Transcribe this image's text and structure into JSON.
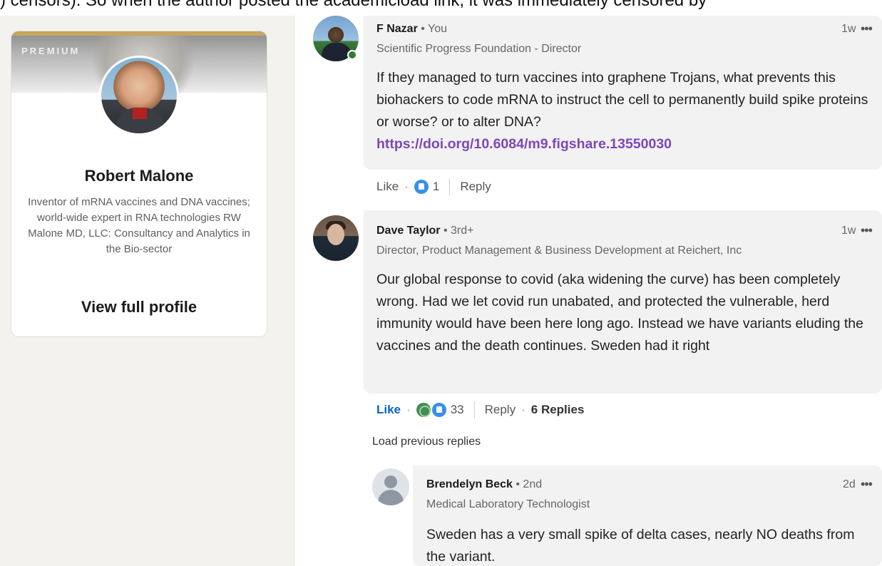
{
  "top_text": ") censors). So when the author posted the academicload link, it was immediately censored by",
  "profile_card": {
    "premium_label": "PREMIUM",
    "name": "Robert Malone",
    "headline": "Inventor of mRNA vaccines and DNA vaccines; world-wide expert in RNA technologies RW Malone MD, LLC: Consultancy and Analytics in the Bio-sector",
    "view_profile": "View full profile"
  },
  "comments": [
    {
      "name": "F Nazar",
      "degree": " • You",
      "title": "Scientific Progress Foundation - Director",
      "time": "1w",
      "more": "•••",
      "body": "If they managed to turn vaccines into graphene Trojans, what prevents this biohackers to code mRNA to instruct the cell to permanently build spike proteins or worse? or to alter DNA?",
      "link": "https://doi.org/10.6084/m9.figshare.13550030",
      "like": "Like",
      "dot": "·",
      "reaction_count": "1",
      "reply": "Reply"
    },
    {
      "name": "Dave Taylor",
      "degree": " • 3rd+",
      "title": "Director, Product Management & Business Development at Reichert, Inc",
      "time": "1w",
      "more": "•••",
      "body": "Our global response to covid (aka widening the curve) has been completely wrong. Had we let covid run unabated, and protected the vulnerable, herd immunity would have been here long ago. Instead we have variants eluding the vaccines and the death continues. Sweden had it right",
      "like": "Like",
      "dot": "·",
      "reaction_count": "33",
      "reply": "Reply",
      "replies": "6 Replies"
    }
  ],
  "load_previous": "Load previous replies",
  "reply": {
    "name": "Brendelyn Beck",
    "degree": " • 2nd",
    "title": "Medical Laboratory Technologist",
    "time": "2d",
    "more": "•••",
    "body": "Sweden has a very small spike of delta cases, nearly NO deaths from the variant."
  },
  "colors": {
    "like_blue": "#0a66c2",
    "link_purple": "#7d47b8",
    "online_green": "#2e7d32",
    "bubble_bg": "#f2f2f2",
    "rail_bg": "#f3f2ef"
  }
}
